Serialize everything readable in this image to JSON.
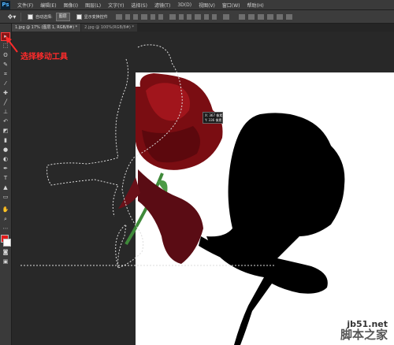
{
  "app": {
    "logo_text": "Ps"
  },
  "menu": [
    "文件(F)",
    "编辑(E)",
    "图像(I)",
    "图层(L)",
    "文字(Y)",
    "选择(S)",
    "滤镜(T)",
    "3D(D)",
    "视图(V)",
    "窗口(W)",
    "帮助(H)"
  ],
  "options_bar": {
    "auto_select_label": "自动选择:",
    "auto_select_target": "图层",
    "show_transform_label": "显示变换控件"
  },
  "tabs": [
    {
      "label": "1.jpg @ 17% (图层 1, RGB/8#) *"
    },
    {
      "label": "2.jpg @ 100%(RGB/8#) *"
    }
  ],
  "annotation": {
    "text": "选择移动工具"
  },
  "tooltip": {
    "line1": "X: 367 像素",
    "line2": "Y: 336 像素"
  },
  "watermark": {
    "site": "jb51.net",
    "name": "脚本之家"
  },
  "colors": {
    "accent": "#ff2b2b",
    "foreground": "#e21b1b",
    "background": "#ffffff"
  },
  "tools": [
    "move-tool",
    "marquee-tool",
    "lasso-tool",
    "quick-select-tool",
    "crop-tool",
    "eyedropper-tool",
    "healing-tool",
    "brush-tool",
    "clone-stamp-tool",
    "history-brush-tool",
    "eraser-tool",
    "gradient-tool",
    "blur-tool",
    "dodge-tool",
    "pen-tool",
    "type-tool",
    "path-select-tool",
    "shape-tool",
    "hand-tool",
    "zoom-tool"
  ]
}
